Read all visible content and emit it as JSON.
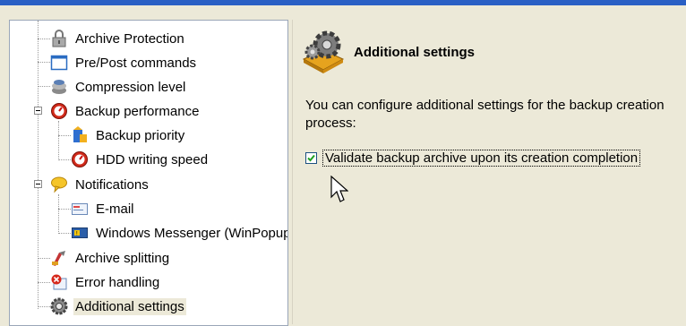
{
  "tree": {
    "items": [
      {
        "label": "Archive Protection",
        "icon": "lock-icon"
      },
      {
        "label": "Pre/Post commands",
        "icon": "window-icon"
      },
      {
        "label": "Compression level",
        "icon": "compress-icon"
      },
      {
        "label": "Backup performance",
        "icon": "gauge-icon"
      },
      {
        "label": "Backup priority",
        "icon": "priority-icon"
      },
      {
        "label": "HDD writing speed",
        "icon": "gauge-icon"
      },
      {
        "label": "Notifications",
        "icon": "speech-bubble-icon"
      },
      {
        "label": "E-mail",
        "icon": "email-icon"
      },
      {
        "label": "Windows Messenger (WinPopup)",
        "icon": "messenger-icon"
      },
      {
        "label": "Archive splitting",
        "icon": "split-icon"
      },
      {
        "label": "Error handling",
        "icon": "error-icon"
      },
      {
        "label": "Additional settings",
        "icon": "settings-gear-icon"
      }
    ],
    "selected_index": 11
  },
  "detail": {
    "title": "Additional settings",
    "description": "You can configure additional settings for the backup creation process:",
    "option_label": "Validate backup archive upon its creation completion",
    "option_checked": true
  },
  "colors": {
    "accent_blue": "#2a5fc4",
    "panel_bg": "#ece9d8",
    "tree_bg": "#ffffff",
    "checkbox_border": "#1c5180",
    "check_mark": "#21a121"
  }
}
